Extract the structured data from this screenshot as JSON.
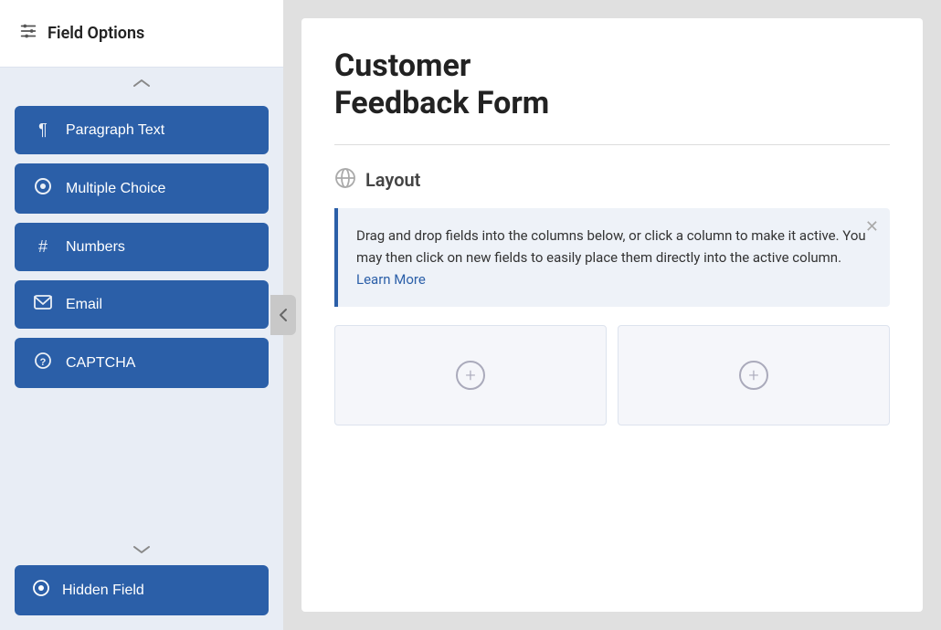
{
  "sidebar": {
    "header": {
      "icon": "⚙",
      "title": "Field Options"
    },
    "scroll_up_label": "∨",
    "fields": [
      {
        "id": "paragraph-text",
        "icon": "¶",
        "label": "Paragraph Text"
      },
      {
        "id": "multiple-choice",
        "icon": "◎",
        "label": "Multiple Choice"
      },
      {
        "id": "numbers",
        "icon": "#",
        "label": "Numbers"
      },
      {
        "id": "email",
        "icon": "✉",
        "label": "Email"
      },
      {
        "id": "captcha",
        "icon": "?",
        "label": "CAPTCHA"
      }
    ],
    "scroll_down_label": "∨",
    "bottom_field": {
      "icon": "◎",
      "label": "Hidden Field"
    }
  },
  "collapse_handle_label": "‹",
  "main": {
    "form_title_line1": "Customer",
    "form_title_line2": "Feedback Form",
    "layout_section": {
      "icon_label": "layout-icon",
      "title": "Layout"
    },
    "info_box": {
      "text": "Drag and drop fields into the columns below, or click a column to make it active. You may then click on new fields to easily place them directly into the active column.",
      "link_text": "Learn More",
      "close_label": "✕"
    },
    "columns": [
      {
        "id": "col-1",
        "plus": "+"
      },
      {
        "id": "col-2",
        "plus": "+"
      }
    ]
  }
}
